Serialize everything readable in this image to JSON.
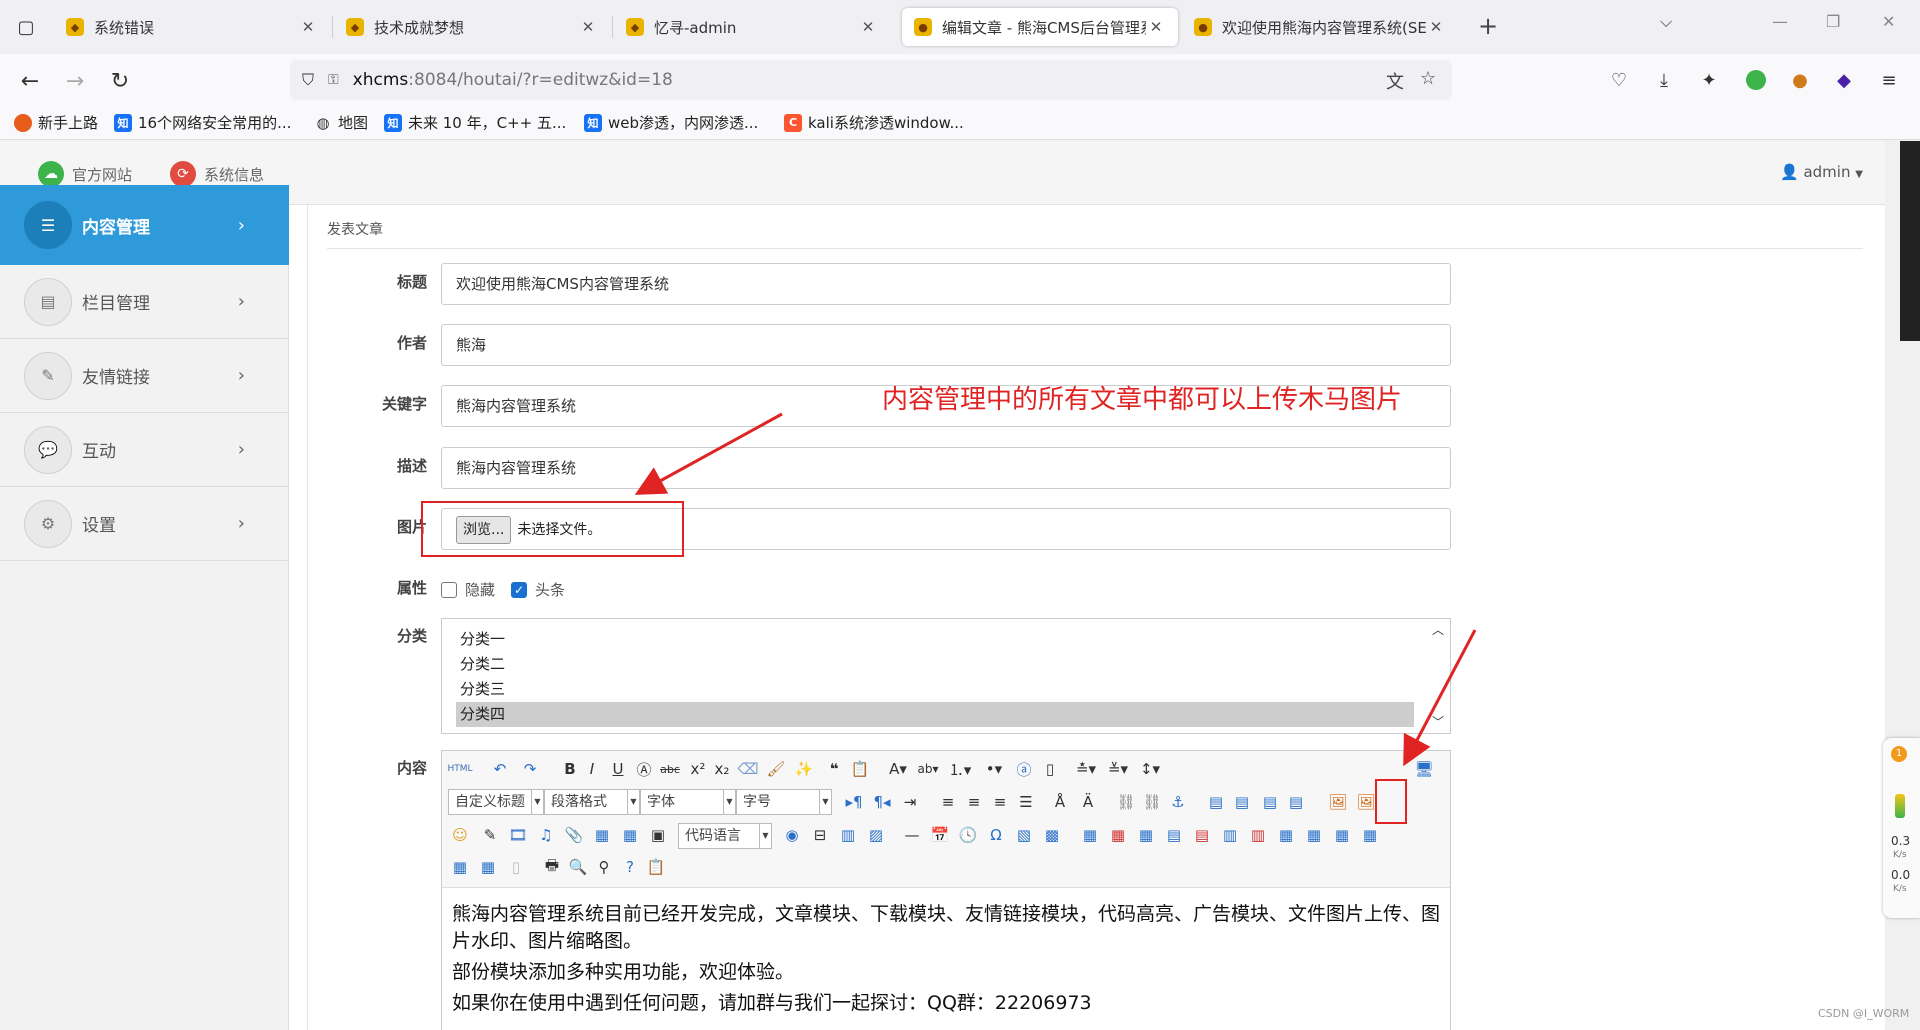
{
  "browser": {
    "tabs": [
      {
        "label": "系统错误",
        "active": false
      },
      {
        "label": "技术成就梦想",
        "active": false
      },
      {
        "label": "忆寻-admin",
        "active": false
      },
      {
        "label": "编辑文章 - 熊海CMS后台管理系",
        "active": true
      },
      {
        "label": "欢迎使用熊海内容管理系统(SEO",
        "active": false
      }
    ],
    "url_host": "xhcms",
    "url_rest": ":8084/houtai/?r=editwz&id=18",
    "bookmarks": [
      {
        "label": "新手上路",
        "icon": "firefox-icon"
      },
      {
        "label": "16个网络安全常用的...",
        "icon": "zhihu-icon",
        "badge": "知"
      },
      {
        "label": "地图",
        "icon": "globe-icon"
      },
      {
        "label": "未来 10 年，C++ 五...",
        "icon": "zhihu-icon",
        "badge": "知"
      },
      {
        "label": "web渗透，内网渗透...",
        "icon": "zhihu-icon",
        "badge": "知"
      },
      {
        "label": "kali系统渗透window...",
        "icon": "csdn-icon",
        "badge": "C"
      }
    ]
  },
  "topbar": {
    "official_site": "官方网站",
    "system_info": "系统信息",
    "user": "admin"
  },
  "sidebar": {
    "items": [
      {
        "label": "内容管理",
        "icon": "list-icon",
        "active": true
      },
      {
        "label": "栏目管理",
        "icon": "column-icon",
        "active": false
      },
      {
        "label": "友情链接",
        "icon": "wand-icon",
        "active": false
      },
      {
        "label": "互动",
        "icon": "chat-icon",
        "active": false
      },
      {
        "label": "设置",
        "icon": "gear-icon",
        "active": false
      }
    ]
  },
  "form": {
    "breadcrumb": "发表文章",
    "title_label": "标题",
    "title_value": "欢迎使用熊海CMS内容管理系统",
    "author_label": "作者",
    "author_value": "熊海",
    "keywords_label": "关键字",
    "keywords_value": "熊海内容管理系统",
    "desc_label": "描述",
    "desc_value": "熊海内容管理系统",
    "image_label": "图片",
    "browse_button": "浏览...",
    "no_file": "未选择文件。",
    "attr_label": "属性",
    "attr_hidden": "隐藏",
    "attr_headline": "头条",
    "attr_hidden_checked": false,
    "attr_headline_checked": true,
    "category_label": "分类",
    "categories": [
      "分类一",
      "分类二",
      "分类三",
      "分类四"
    ],
    "category_selected": "分类四",
    "content_label": "内容"
  },
  "editor": {
    "selects": {
      "custom_title": "自定义标题",
      "paragraph": "段落格式",
      "font": "字体",
      "size": "字号",
      "code_lang": "代码语言"
    },
    "content": [
      "熊海内容管理系统目前已经开发完成，文章模块、下载模块、友情链接模块，代码高亮、广告模块、文件图片上传、图片水印、图片缩略图。",
      "部份模块添加多种实用功能，欢迎体验。",
      "如果你在使用中遇到任何问题，请加群与我们一起探讨：QQ群：22206973"
    ]
  },
  "annotation": {
    "text": "内容管理中的所有文章中都可以上传木马图片",
    "color": "#e02424"
  },
  "speed": {
    "up": "0.3",
    "down": "0.0",
    "unit": "K/s",
    "badge": "1"
  },
  "watermark": "CSDN @I_WORM"
}
